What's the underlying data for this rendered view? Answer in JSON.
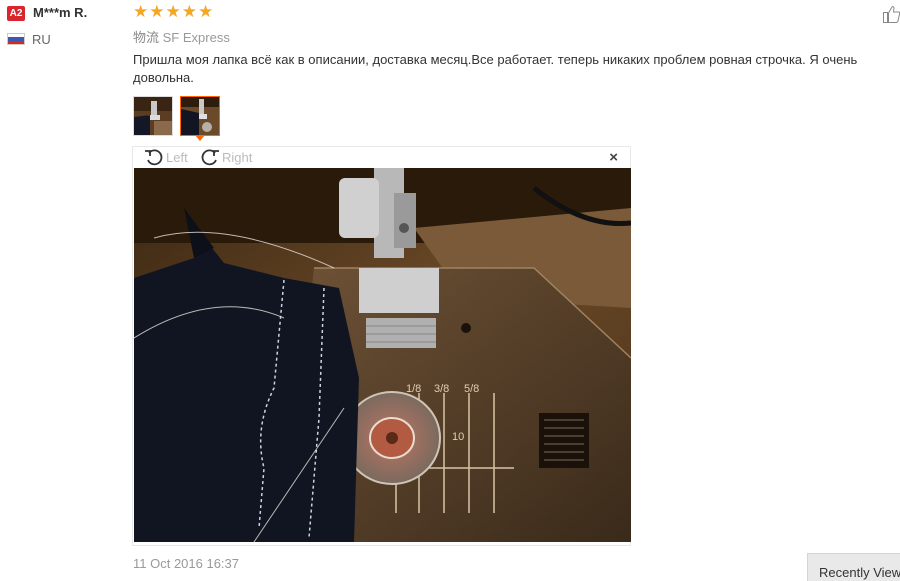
{
  "reviewer": {
    "badge": "A2",
    "name": "M***m R.",
    "country": "RU"
  },
  "rating": {
    "value": 5,
    "max": 5,
    "star_glyph": "★"
  },
  "shipping": {
    "label": "物流",
    "carrier": "SF Express"
  },
  "review": {
    "text": "Пришла моя лапка всё как в описании, доставка месяц.Все работает. теперь никаких проблем ровная строчка. Я очень довольна.",
    "date": "11 Oct 2016 16:37"
  },
  "thumbnails": [
    {
      "icon": "sewing-machine-photo-thumbnail",
      "active": false
    },
    {
      "icon": "sewing-machine-photo-thumbnail",
      "active": true
    }
  ],
  "viewer": {
    "rotate_left_label": "Left",
    "rotate_right_label": "Right",
    "close_glyph": "×",
    "photo_icon": "sewing-machine-presser-foot-photo"
  },
  "sidebar": {
    "recently_viewed_label": "Recently Viewed"
  },
  "colors": {
    "badge": "#d9262c",
    "star": "#f5a623",
    "thumb_active": "#ff6600"
  }
}
